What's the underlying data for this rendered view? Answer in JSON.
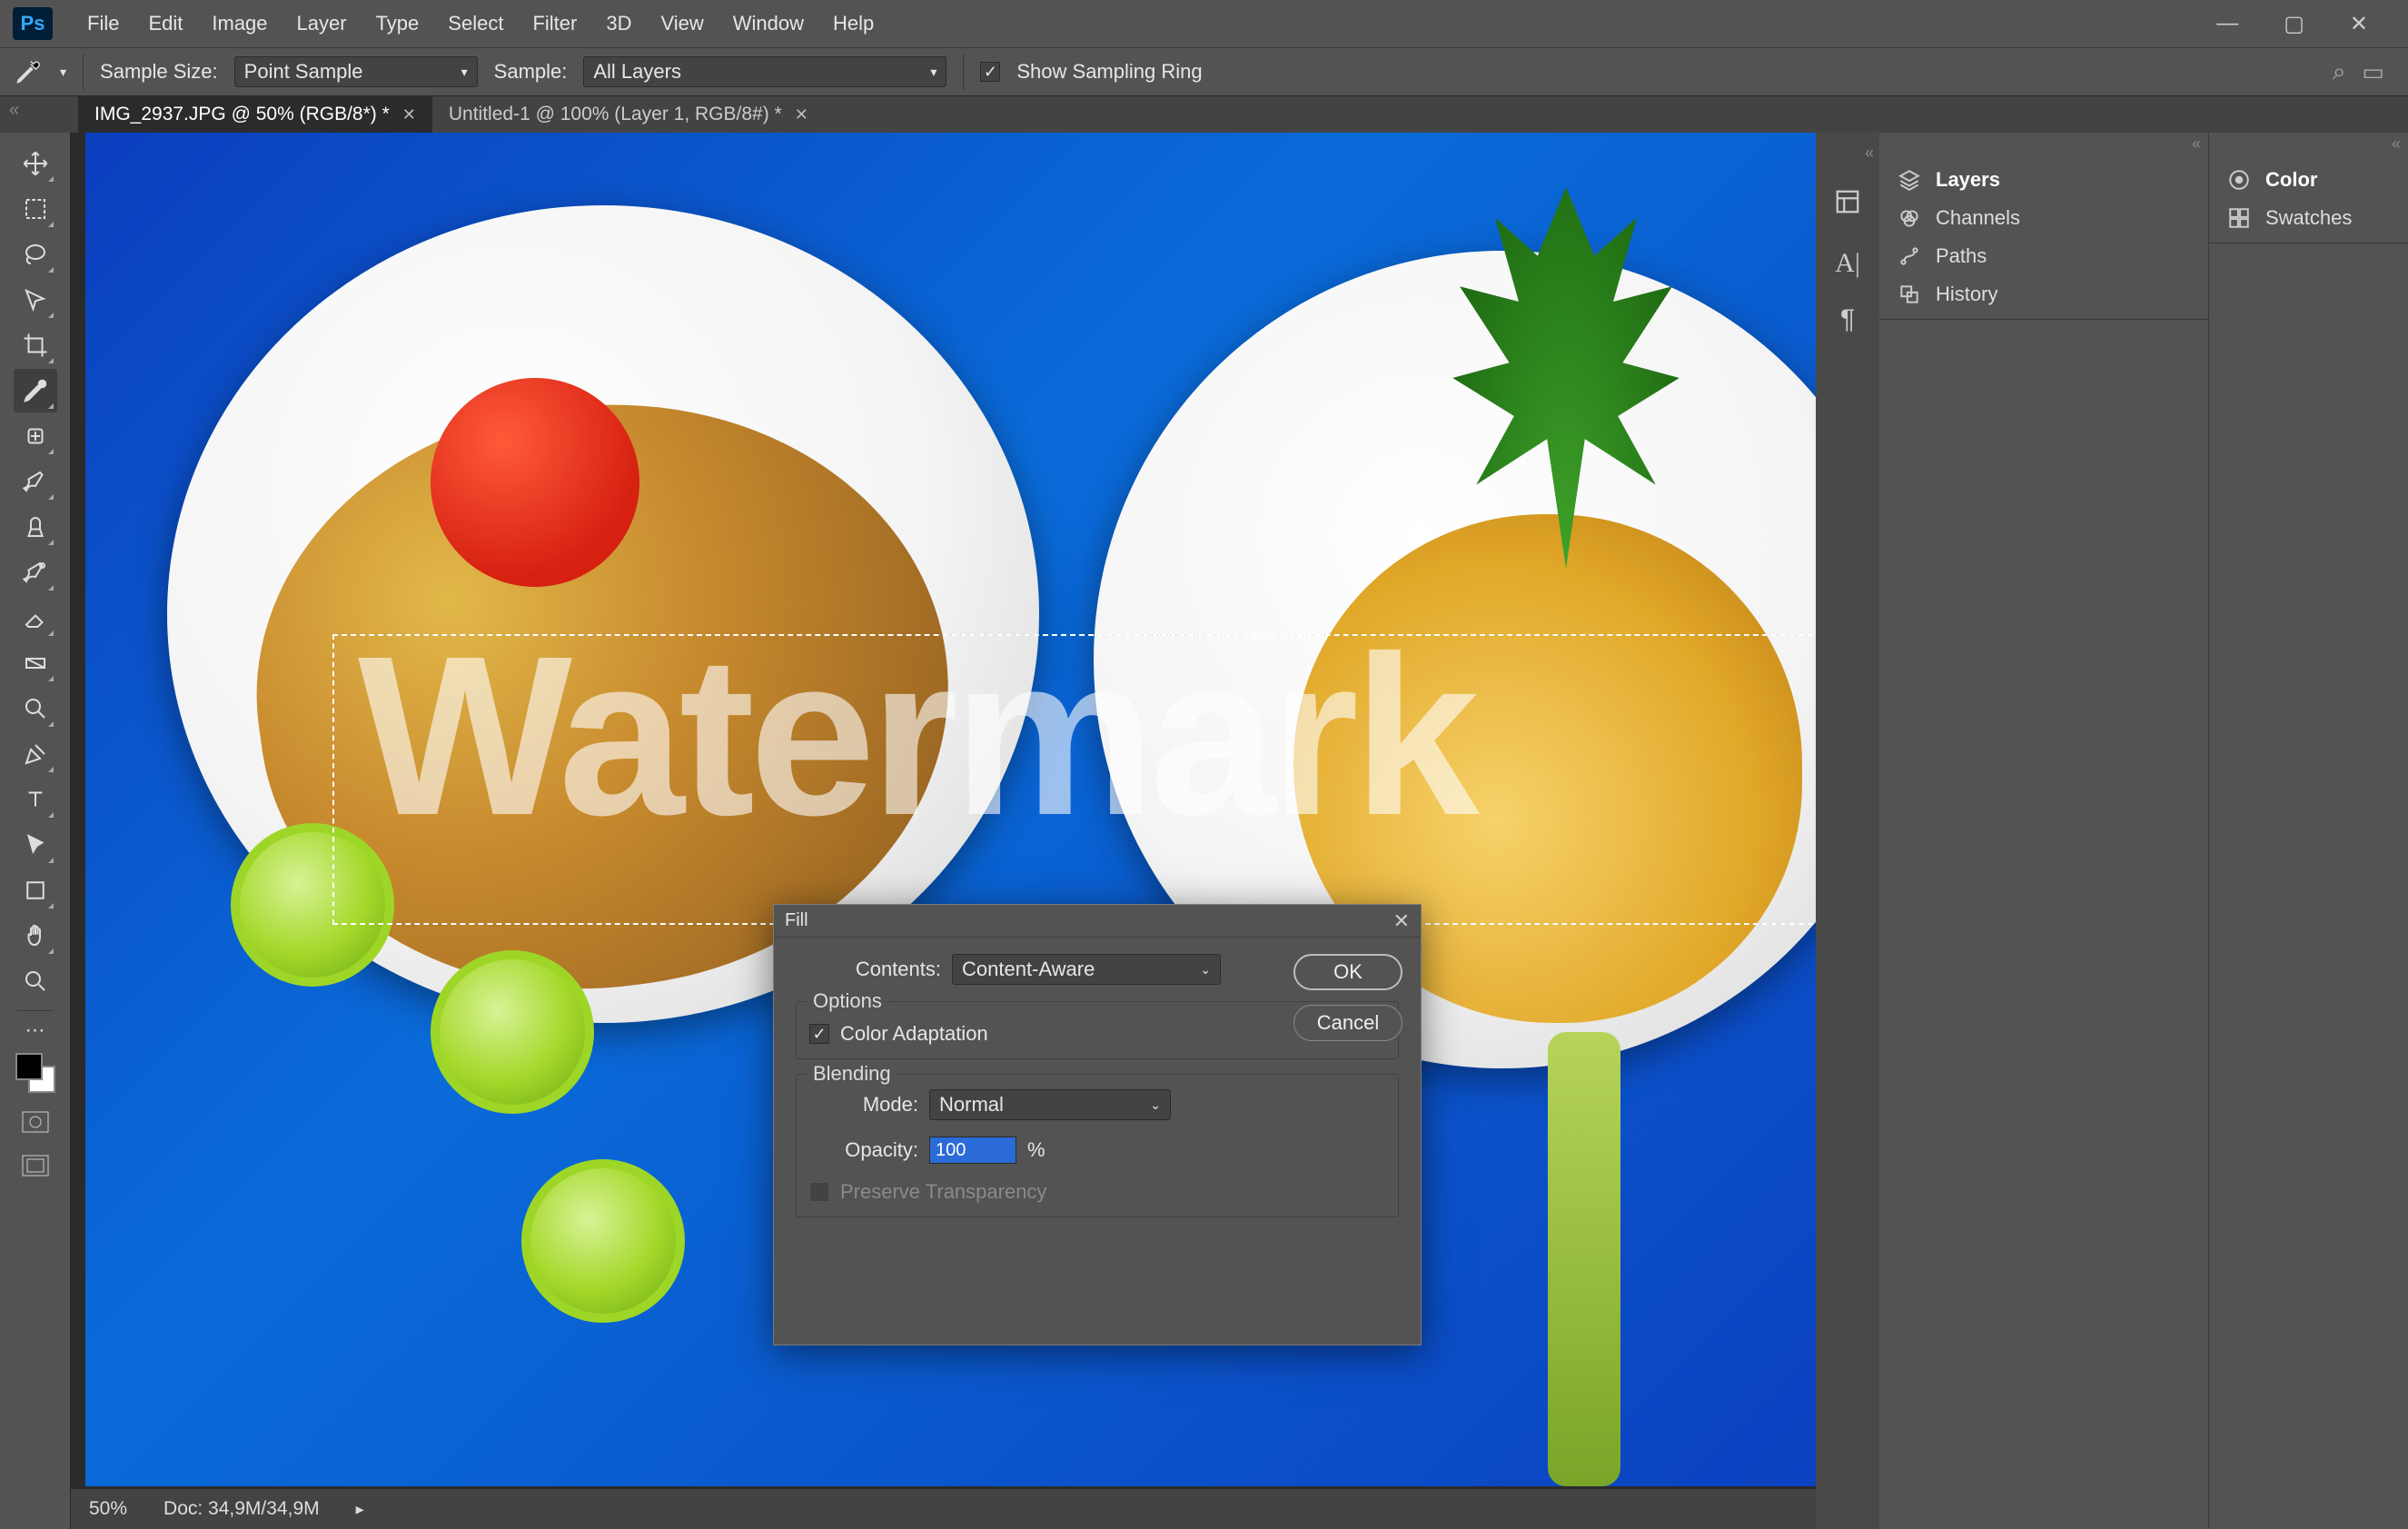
{
  "app": {
    "logo": "Ps"
  },
  "menu": [
    "File",
    "Edit",
    "Image",
    "Layer",
    "Type",
    "Select",
    "Filter",
    "3D",
    "View",
    "Window",
    "Help"
  ],
  "optionbar": {
    "sample_size_label": "Sample Size:",
    "sample_size_value": "Point Sample",
    "sample_label": "Sample:",
    "sample_value": "All Layers",
    "show_ring_label": "Show Sampling Ring",
    "show_ring_checked": true
  },
  "tabs": [
    {
      "label": "IMG_2937.JPG @ 50% (RGB/8*) *",
      "active": true
    },
    {
      "label": "Untitled-1 @ 100% (Layer 1, RGB/8#) *",
      "active": false
    }
  ],
  "canvas": {
    "watermark_text": "Watermark"
  },
  "statusbar": {
    "zoom": "50%",
    "docinfo": "Doc: 34,9M/34,9M"
  },
  "panels_left_strip": [
    "layers-icon",
    "character-icon",
    "paragraph-icon"
  ],
  "panel_group1": [
    {
      "label": "Layers",
      "bold": true
    },
    {
      "label": "Channels",
      "bold": false
    },
    {
      "label": "Paths",
      "bold": false
    },
    {
      "label": "History",
      "bold": false
    }
  ],
  "panel_group2": [
    {
      "label": "Color",
      "bold": true
    },
    {
      "label": "Swatches",
      "bold": false
    }
  ],
  "dialog": {
    "title": "Fill",
    "contents_label": "Contents:",
    "contents_value": "Content-Aware",
    "options_legend": "Options",
    "color_adaptation_label": "Color Adaptation",
    "color_adaptation_checked": true,
    "blending_legend": "Blending",
    "mode_label": "Mode:",
    "mode_value": "Normal",
    "opacity_label": "Opacity:",
    "opacity_value": "100",
    "opacity_unit": "%",
    "preserve_label": "Preserve Transparency",
    "ok": "OK",
    "cancel": "Cancel"
  }
}
